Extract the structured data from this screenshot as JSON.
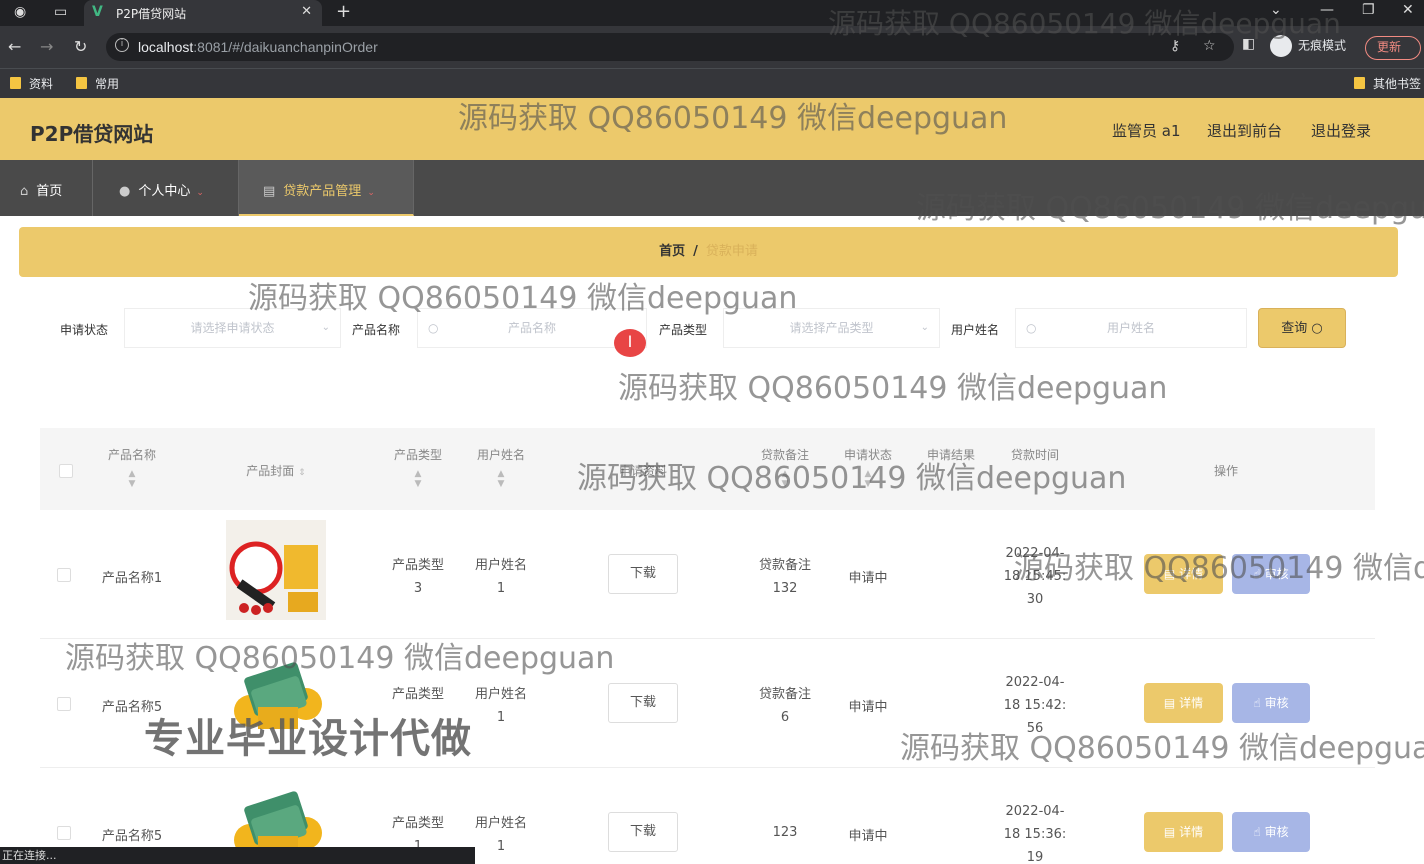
{
  "browser": {
    "tab_title": "P2P借贷网站",
    "tab_favicon": "V",
    "url_host": "localhost",
    "url_rest": ":8081/#/daikuanchanpinOrder",
    "incognito_label": "无痕模式",
    "update_label": "更新",
    "bookmarks": [
      "资料",
      "常用"
    ],
    "other_bookmarks": "其他书签",
    "status_text": "正在连接..."
  },
  "header": {
    "site_title": "P2P借贷网站",
    "user": "监管员 a1",
    "back_front": "退出到前台",
    "logout": "退出登录"
  },
  "nav": {
    "home": "首页",
    "personal": "个人中心",
    "loan_products": "贷款产品管理"
  },
  "breadcrumb": {
    "home": "首页",
    "sep": "/",
    "current": "贷款申请"
  },
  "filters": {
    "status_label": "申请状态",
    "status_placeholder": "请选择申请状态",
    "name_label": "产品名称",
    "name_placeholder": "产品名称",
    "type_label": "产品类型",
    "type_placeholder": "请选择产品类型",
    "user_label": "用户姓名",
    "user_placeholder": "用户姓名",
    "query_button": "查询"
  },
  "table": {
    "headers": {
      "name": "产品名称",
      "cover": "产品封面",
      "type": "产品类型",
      "user": "用户姓名",
      "file": "申请资料",
      "remark": "贷款备注",
      "status": "申请状态",
      "result": "申请结果",
      "time": "贷款时间",
      "actions": "操作"
    },
    "download_label": "下载",
    "detail_label": "详情",
    "review_label": "审核",
    "rows": [
      {
        "name": "产品名称1",
        "type_l1": "产品类型",
        "type_l2": "3",
        "user_l1": "用户姓名",
        "user_l2": "1",
        "remark_l1": "贷款备注",
        "remark_l2": "132",
        "status": "申请中",
        "time_l1": "2022-04-",
        "time_l2": "18 15:45:",
        "time_l3": "30"
      },
      {
        "name": "产品名称5",
        "type_l1": "产品类型",
        "type_l2": "",
        "user_l1": "用户姓名",
        "user_l2": "1",
        "remark_l1": "贷款备注",
        "remark_l2": "6",
        "status": "申请中",
        "time_l1": "2022-04-",
        "time_l2": "18 15:42:",
        "time_l3": "56"
      },
      {
        "name": "产品名称5",
        "type_l1": "产品类型",
        "type_l2": "1",
        "user_l1": "用户姓名",
        "user_l2": "1",
        "remark_l1": "",
        "remark_l2": "123",
        "status": "申请中",
        "time_l1": "2022-04-",
        "time_l2": "18 15:36:",
        "time_l3": "19"
      }
    ]
  },
  "watermarks": {
    "text": "源码获取 QQ86050149 微信deepguan",
    "text_clipped_top": "源码获取 QQ86050149 微信deepguan",
    "text_clipped_right1": "源码获取 QQ86050149 微信deepgua",
    "text_clipped_right2": "源码获取 QQ86050149 微信d",
    "text_clipped_right3": "源码获取 QQ86050149 微信deepguar",
    "big": "专业毕业设计代做"
  }
}
